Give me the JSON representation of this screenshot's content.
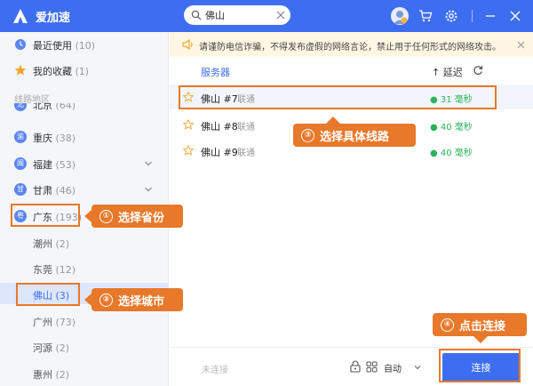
{
  "app": {
    "name": "爱加速"
  },
  "search": {
    "value": "佛山"
  },
  "colors": {
    "accent": "#3d6ef0",
    "highlight": "#e8782a",
    "latency": "#2bb35a",
    "notice_bg": "#fff7e3"
  },
  "sidebar": {
    "recent": {
      "label": "最近使用",
      "count": "(10)"
    },
    "favorites": {
      "label": "我的收藏",
      "count": "(1)"
    },
    "section_title": "线路地区",
    "provinces": [
      {
        "abbr": "北",
        "label": "北京",
        "count": "(64)"
      },
      {
        "abbr": "渝",
        "label": "重庆",
        "count": "(38)"
      },
      {
        "abbr": "闽",
        "label": "福建",
        "count": "(53)"
      },
      {
        "abbr": "甘",
        "label": "甘肃",
        "count": "(46)"
      },
      {
        "abbr": "粤",
        "label": "广东",
        "count": "(193)"
      }
    ],
    "cities": [
      {
        "label": "潮州",
        "count": "(2)"
      },
      {
        "label": "东莞",
        "count": "(12)"
      },
      {
        "label": "佛山",
        "count": "(3)"
      },
      {
        "label": "广州",
        "count": "(73)"
      },
      {
        "label": "河源",
        "count": "(2)"
      },
      {
        "label": "惠州",
        "count": "(2)"
      }
    ]
  },
  "notice": {
    "text": "请谨防电信诈骗，不得发布虚假的网络言论，禁止用于任何形式的网络攻击。"
  },
  "table": {
    "header_server": "服务器",
    "header_latency": "↑ 延迟",
    "rows": [
      {
        "name": "佛山 #7",
        "isp": "联通",
        "latency": "● 31 毫秒"
      },
      {
        "name": "佛山 #8",
        "isp": "联通",
        "latency": "● 40 毫秒"
      },
      {
        "name": "佛山 #9",
        "isp": "联通",
        "latency": "● 40 毫秒"
      }
    ]
  },
  "bottom": {
    "status": "未连接",
    "mode": "自动",
    "connect_label": "连接"
  },
  "callouts": {
    "step1": {
      "num": "①",
      "text": "选择省份"
    },
    "step2": {
      "num": "②",
      "text": "选择城市"
    },
    "step3": {
      "num": "③",
      "text": "选择具体线路"
    },
    "step4": {
      "num": "④",
      "text": "点击连接"
    }
  }
}
